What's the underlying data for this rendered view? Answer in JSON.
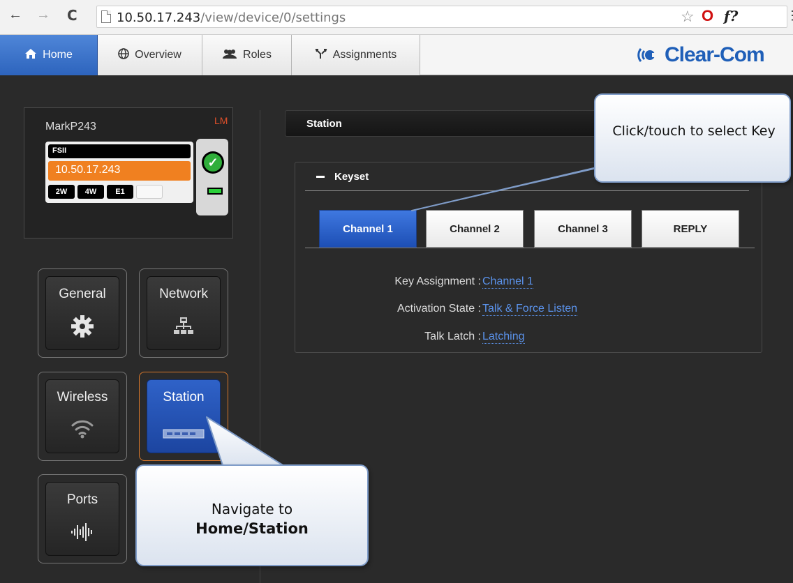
{
  "browser": {
    "back": "←",
    "forward": "→",
    "reload": "C",
    "url_host": "10.50.17.243",
    "url_path": "/view/device/0/settings",
    "star": "☆",
    "ext_opera": "O",
    "ext_f": "f?",
    "menu": "⋮"
  },
  "nav": {
    "tabs": [
      {
        "label": "Home",
        "icon": "home-icon",
        "glyph": "⌂"
      },
      {
        "label": "Overview",
        "icon": "globe-icon",
        "glyph": "◍"
      },
      {
        "label": "Roles",
        "icon": "users-icon",
        "glyph": "👥"
      },
      {
        "label": "Assignments",
        "icon": "assignments-icon",
        "glyph": "⤨"
      }
    ],
    "logo_text": "Clear-Com"
  },
  "device": {
    "name": "MarkP243",
    "badge": "LM",
    "model": "FSII",
    "ip": "10.50.17.243",
    "ports": [
      "2W",
      "4W",
      "E1",
      ""
    ],
    "status": "online"
  },
  "tiles": [
    {
      "label": "General",
      "icon": "gear-icon",
      "glyph": "⚙"
    },
    {
      "label": "Network",
      "icon": "network-icon",
      "glyph": "品"
    },
    {
      "label": "Wireless",
      "icon": "wifi-icon",
      "glyph": "◠"
    },
    {
      "label": "Station",
      "icon": "station-icon",
      "glyph": "▭"
    },
    {
      "label": "Ports",
      "icon": "ports-icon",
      "glyph": "ılıılı"
    }
  ],
  "station": {
    "header": "Station",
    "keyset_title": "Keyset",
    "keys": [
      "Channel 1",
      "Channel 2",
      "Channel 3",
      "REPLY"
    ],
    "selected_key": "Channel 1",
    "props": [
      {
        "key": "Key Assignment :",
        "value": "Channel 1"
      },
      {
        "key": "Activation State :",
        "value": "Talk & Force Listen"
      },
      {
        "key": "Talk Latch :",
        "value": "Latching"
      }
    ]
  },
  "callouts": {
    "select_key": "Click/touch to select Key",
    "navigate_line1": "Navigate to",
    "navigate_line2": "Home/Station"
  },
  "colors": {
    "accent_blue": "#2d64bd",
    "brand_blue": "#1f5fb8",
    "active_orange": "#d9782b",
    "ip_orange": "#f08020",
    "link_blue": "#5b93ec"
  }
}
